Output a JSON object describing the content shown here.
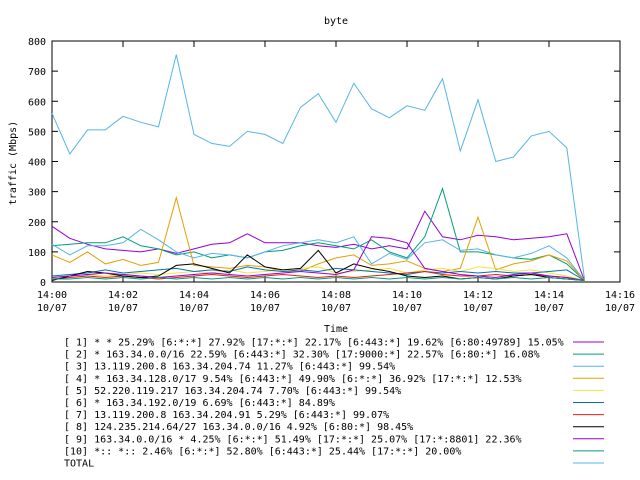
{
  "chart_data": {
    "type": "line",
    "title": "byte",
    "xlabel": "Time",
    "ylabel": "traffic (Mbps)",
    "ylim": [
      0,
      800
    ],
    "y_ticks": [
      "0",
      "100",
      "200",
      "300",
      "400",
      "500",
      "600",
      "700",
      "800"
    ],
    "x_ticks": [
      {
        "time": "14:00",
        "date": "10/07"
      },
      {
        "time": "14:02",
        "date": "10/07"
      },
      {
        "time": "14:04",
        "date": "10/07"
      },
      {
        "time": "14:06",
        "date": "10/07"
      },
      {
        "time": "14:08",
        "date": "10/07"
      },
      {
        "time": "14:10",
        "date": "10/07"
      },
      {
        "time": "14:12",
        "date": "10/07"
      },
      {
        "time": "14:14",
        "date": "10/07"
      },
      {
        "time": "14:16",
        "date": "10/07"
      }
    ],
    "xlim": [
      "14:00",
      "14:16"
    ],
    "x": [
      "14:00:00",
      "14:00:30",
      "14:01:00",
      "14:01:30",
      "14:02:00",
      "14:02:30",
      "14:03:00",
      "14:03:30",
      "14:04:00",
      "14:04:30",
      "14:05:00",
      "14:05:30",
      "14:06:00",
      "14:06:30",
      "14:07:00",
      "14:07:30",
      "14:08:00",
      "14:08:30",
      "14:09:00",
      "14:09:30",
      "14:10:00",
      "14:10:30",
      "14:11:00",
      "14:11:30",
      "14:12:00",
      "14:12:30",
      "14:13:00",
      "14:13:30",
      "14:14:00",
      "14:14:30",
      "14:15:00"
    ],
    "grid": false,
    "legend_position": "bottom",
    "series": [
      {
        "name": "[ 1] * * 25.29%  [6:*:*] 27.92% [17:*:*] 22.17% [6:443:*] 19.62% [6:80:49789] 15.05%",
        "color": "#9400d3",
        "values": [
          185,
          145,
          125,
          110,
          105,
          100,
          110,
          95,
          110,
          125,
          130,
          160,
          130,
          130,
          130,
          120,
          115,
          125,
          110,
          120,
          110,
          235,
          150,
          140,
          155,
          150,
          140,
          145,
          150,
          160,
          5
        ]
      },
      {
        "name": "[ 2] * 163.34.0.0/16 22.59%  [6:443:*] 32.30% [17:9000:*] 22.57% [6:80:*] 16.08%",
        "color": "#009e73",
        "values": [
          120,
          125,
          130,
          130,
          150,
          120,
          110,
          90,
          100,
          80,
          90,
          80,
          100,
          105,
          120,
          130,
          120,
          110,
          140,
          100,
          80,
          150,
          310,
          100,
          100,
          90,
          80,
          75,
          90,
          60,
          5
        ]
      },
      {
        "name": "[ 3] 13.119.200.8 163.34.204.74 11.27%  [6:443:*] 99.54%",
        "color": "#56b4e9",
        "values": [
          125,
          90,
          120,
          120,
          130,
          175,
          140,
          100,
          80,
          95,
          90,
          80,
          100,
          120,
          130,
          140,
          130,
          150,
          60,
          95,
          75,
          130,
          140,
          105,
          110,
          90,
          80,
          95,
          120,
          80,
          5
        ]
      },
      {
        "name": "[ 4] * 163.34.128.0/17 9.54%  [6:443:*] 49.90% [6:*:*] 36.92% [17:*:*] 12.53%",
        "color": "#e69f00",
        "values": [
          90,
          65,
          100,
          60,
          75,
          55,
          65,
          280,
          55,
          50,
          45,
          55,
          50,
          35,
          35,
          60,
          80,
          90,
          55,
          60,
          70,
          45,
          35,
          45,
          215,
          40,
          60,
          70,
          90,
          70,
          5
        ]
      },
      {
        "name": "[ 5] 52.220.119.217 163.34.204.74 7.70%  [6:443:*] 99.54%",
        "color": "#f0e442",
        "values": [
          15,
          20,
          25,
          20,
          25,
          30,
          25,
          30,
          35,
          30,
          40,
          30,
          35,
          40,
          45,
          50,
          30,
          35,
          40,
          45,
          30,
          40,
          45,
          35,
          50,
          45,
          35,
          40,
          30,
          20,
          5
        ]
      },
      {
        "name": "[ 6] * 163.34.192.0/19 6.69%  [6:443:*] 84.89%",
        "color": "#0072b2",
        "values": [
          20,
          25,
          30,
          40,
          30,
          35,
          40,
          45,
          35,
          40,
          35,
          50,
          40,
          35,
          40,
          35,
          45,
          40,
          35,
          30,
          25,
          35,
          30,
          35,
          30,
          35,
          30,
          30,
          35,
          40,
          5
        ]
      },
      {
        "name": "[ 7] 13.119.200.8 163.34.204.91 5.29%  [6:443:*] 99.07%",
        "color": "#e51e10",
        "values": [
          10,
          15,
          20,
          15,
          20,
          15,
          10,
          15,
          20,
          25,
          20,
          15,
          20,
          25,
          20,
          15,
          20,
          15,
          20,
          25,
          30,
          35,
          25,
          20,
          20,
          25,
          20,
          25,
          20,
          15,
          5
        ]
      },
      {
        "name": "[ 8] 124.235.214.64/27 163.34.0.0/16 4.92%  [6:80:*] 98.45%",
        "color": "#000000",
        "values": [
          5,
          20,
          35,
          30,
          20,
          15,
          20,
          55,
          60,
          45,
          30,
          90,
          50,
          40,
          45,
          105,
          30,
          60,
          45,
          35,
          20,
          15,
          20,
          10,
          15,
          10,
          20,
          25,
          15,
          10,
          5
        ]
      },
      {
        "name": "[ 9] 163.34.0.0/16 * 4.25%  [6:*:*] 51.49% [17:*:*] 25.07% [17:*:8801] 22.36%",
        "color": "#9400d3",
        "values": [
          15,
          20,
          25,
          30,
          25,
          20,
          15,
          20,
          25,
          30,
          25,
          20,
          25,
          30,
          35,
          30,
          25,
          40,
          150,
          145,
          130,
          45,
          35,
          25,
          20,
          15,
          25,
          30,
          20,
          15,
          5
        ]
      },
      {
        "name": "[10] *:: *:: 2.46%  [6:*:*] 52.80% [6:443:*] 25.44% [17:*:*] 20.00%",
        "color": "#009e73",
        "values": [
          10,
          10,
          15,
          10,
          15,
          10,
          15,
          10,
          15,
          10,
          15,
          10,
          15,
          10,
          15,
          10,
          15,
          10,
          15,
          10,
          15,
          10,
          15,
          10,
          15,
          10,
          15,
          10,
          15,
          10,
          5
        ]
      },
      {
        "name": "TOTAL",
        "color": "#56b4e9",
        "values": [
          560,
          425,
          505,
          505,
          550,
          530,
          515,
          755,
          490,
          460,
          450,
          500,
          490,
          460,
          580,
          625,
          530,
          660,
          575,
          545,
          585,
          570,
          675,
          435,
          605,
          400,
          415,
          485,
          500,
          445,
          10
        ]
      }
    ]
  }
}
